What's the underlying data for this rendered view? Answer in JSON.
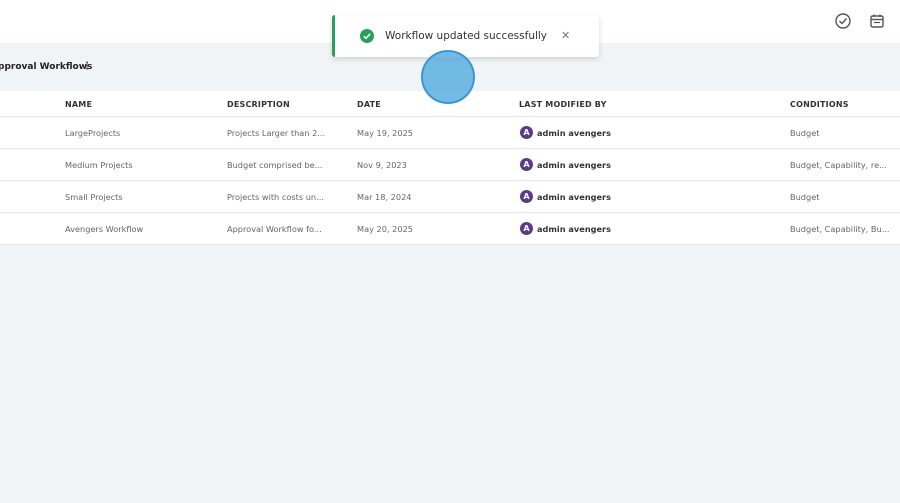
{
  "header": {
    "icons": [
      "check-circle-icon",
      "calendar-icon"
    ]
  },
  "page": {
    "title": "pproval Workflows",
    "more_icon": "⋮"
  },
  "table": {
    "columns": {
      "name": "NAME",
      "description": "DESCRIPTION",
      "date": "DATE",
      "modified_by": "LAST MODIFIED BY",
      "conditions": "CONDITIONS"
    },
    "rows": [
      {
        "name": "LargeProjects",
        "description": "Projects Larger than 2...",
        "date": "May 19, 2025",
        "modified_by": "admin avengers",
        "conditions": "Budget"
      },
      {
        "name": "Medium Projects",
        "description": "Budget comprised be...",
        "date": "Nov 9, 2023",
        "modified_by": "admin avengers",
        "conditions": "Budget, Capability, re..."
      },
      {
        "name": "Small Projects",
        "description": "Projects with costs un...",
        "date": "Mar 18, 2024",
        "modified_by": "admin avengers",
        "conditions": "Budget"
      },
      {
        "name": "Avengers Workflow",
        "description": "Approval Workflow fo...",
        "date": "May 20, 2025",
        "modified_by": "admin avengers",
        "conditions": "Budget, Capability, Bu..."
      }
    ],
    "avatar_letter": "A"
  },
  "toast": {
    "message": "Workflow updated successfully",
    "close": "✕"
  },
  "colors": {
    "success": "#27a15a",
    "avatar": "#5a3b86",
    "cursor": "#5aafe1"
  }
}
